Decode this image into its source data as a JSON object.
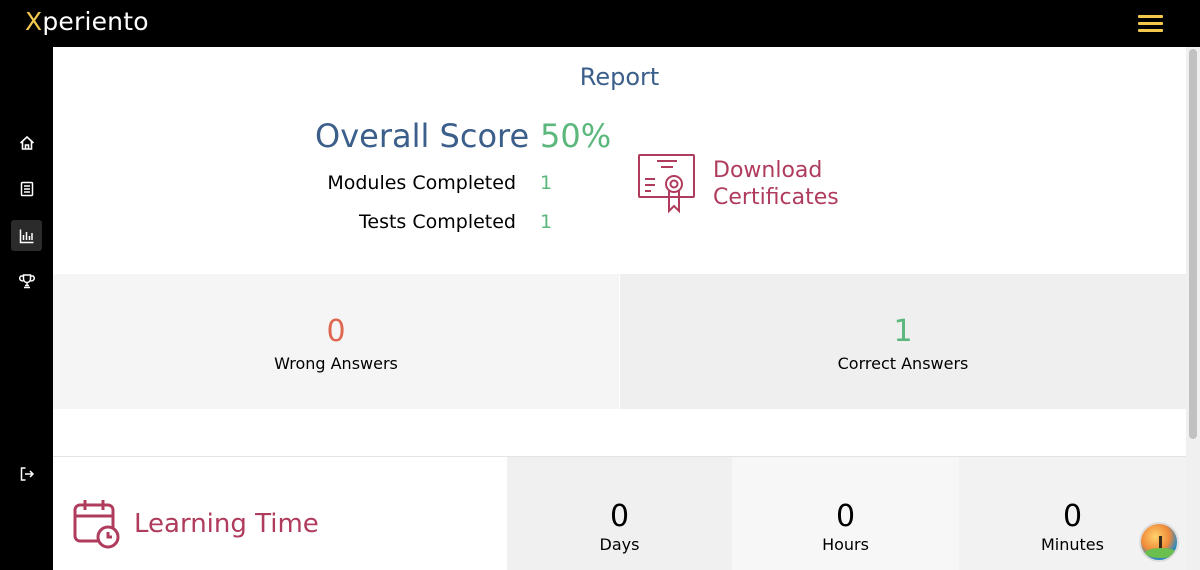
{
  "app": {
    "brand_first": "X",
    "brand_rest": "periento",
    "brand_color": "#f2c94c"
  },
  "sidebar": {
    "items": [
      {
        "name": "home",
        "icon": "home-icon"
      },
      {
        "name": "modules",
        "icon": "book-icon"
      },
      {
        "name": "report",
        "icon": "bar-chart-icon",
        "active": true
      },
      {
        "name": "achievements",
        "icon": "trophy-icon"
      },
      {
        "name": "logout",
        "icon": "logout-icon"
      }
    ]
  },
  "report": {
    "title": "Report",
    "overall_score_label": "Overall Score",
    "overall_score_value": "50%",
    "modules_completed_label": "Modules Completed",
    "modules_completed_value": "1",
    "tests_completed_label": "Tests Completed",
    "tests_completed_value": "1",
    "download_line1": "Download",
    "download_line2": "Certificates"
  },
  "answers": {
    "wrong_value": "0",
    "wrong_label": "Wrong Answers",
    "correct_value": "1",
    "correct_label": "Correct Answers"
  },
  "learning_time": {
    "title": "Learning Time",
    "days_value": "0",
    "days_label": "Days",
    "hours_value": "0",
    "hours_label": "Hours",
    "minutes_value": "0",
    "minutes_label": "Minutes"
  },
  "colors": {
    "accent_blue": "#3b5f8a",
    "accent_green": "#5bb77c",
    "accent_red": "#e0674f",
    "accent_crimson": "#b03c5d"
  }
}
